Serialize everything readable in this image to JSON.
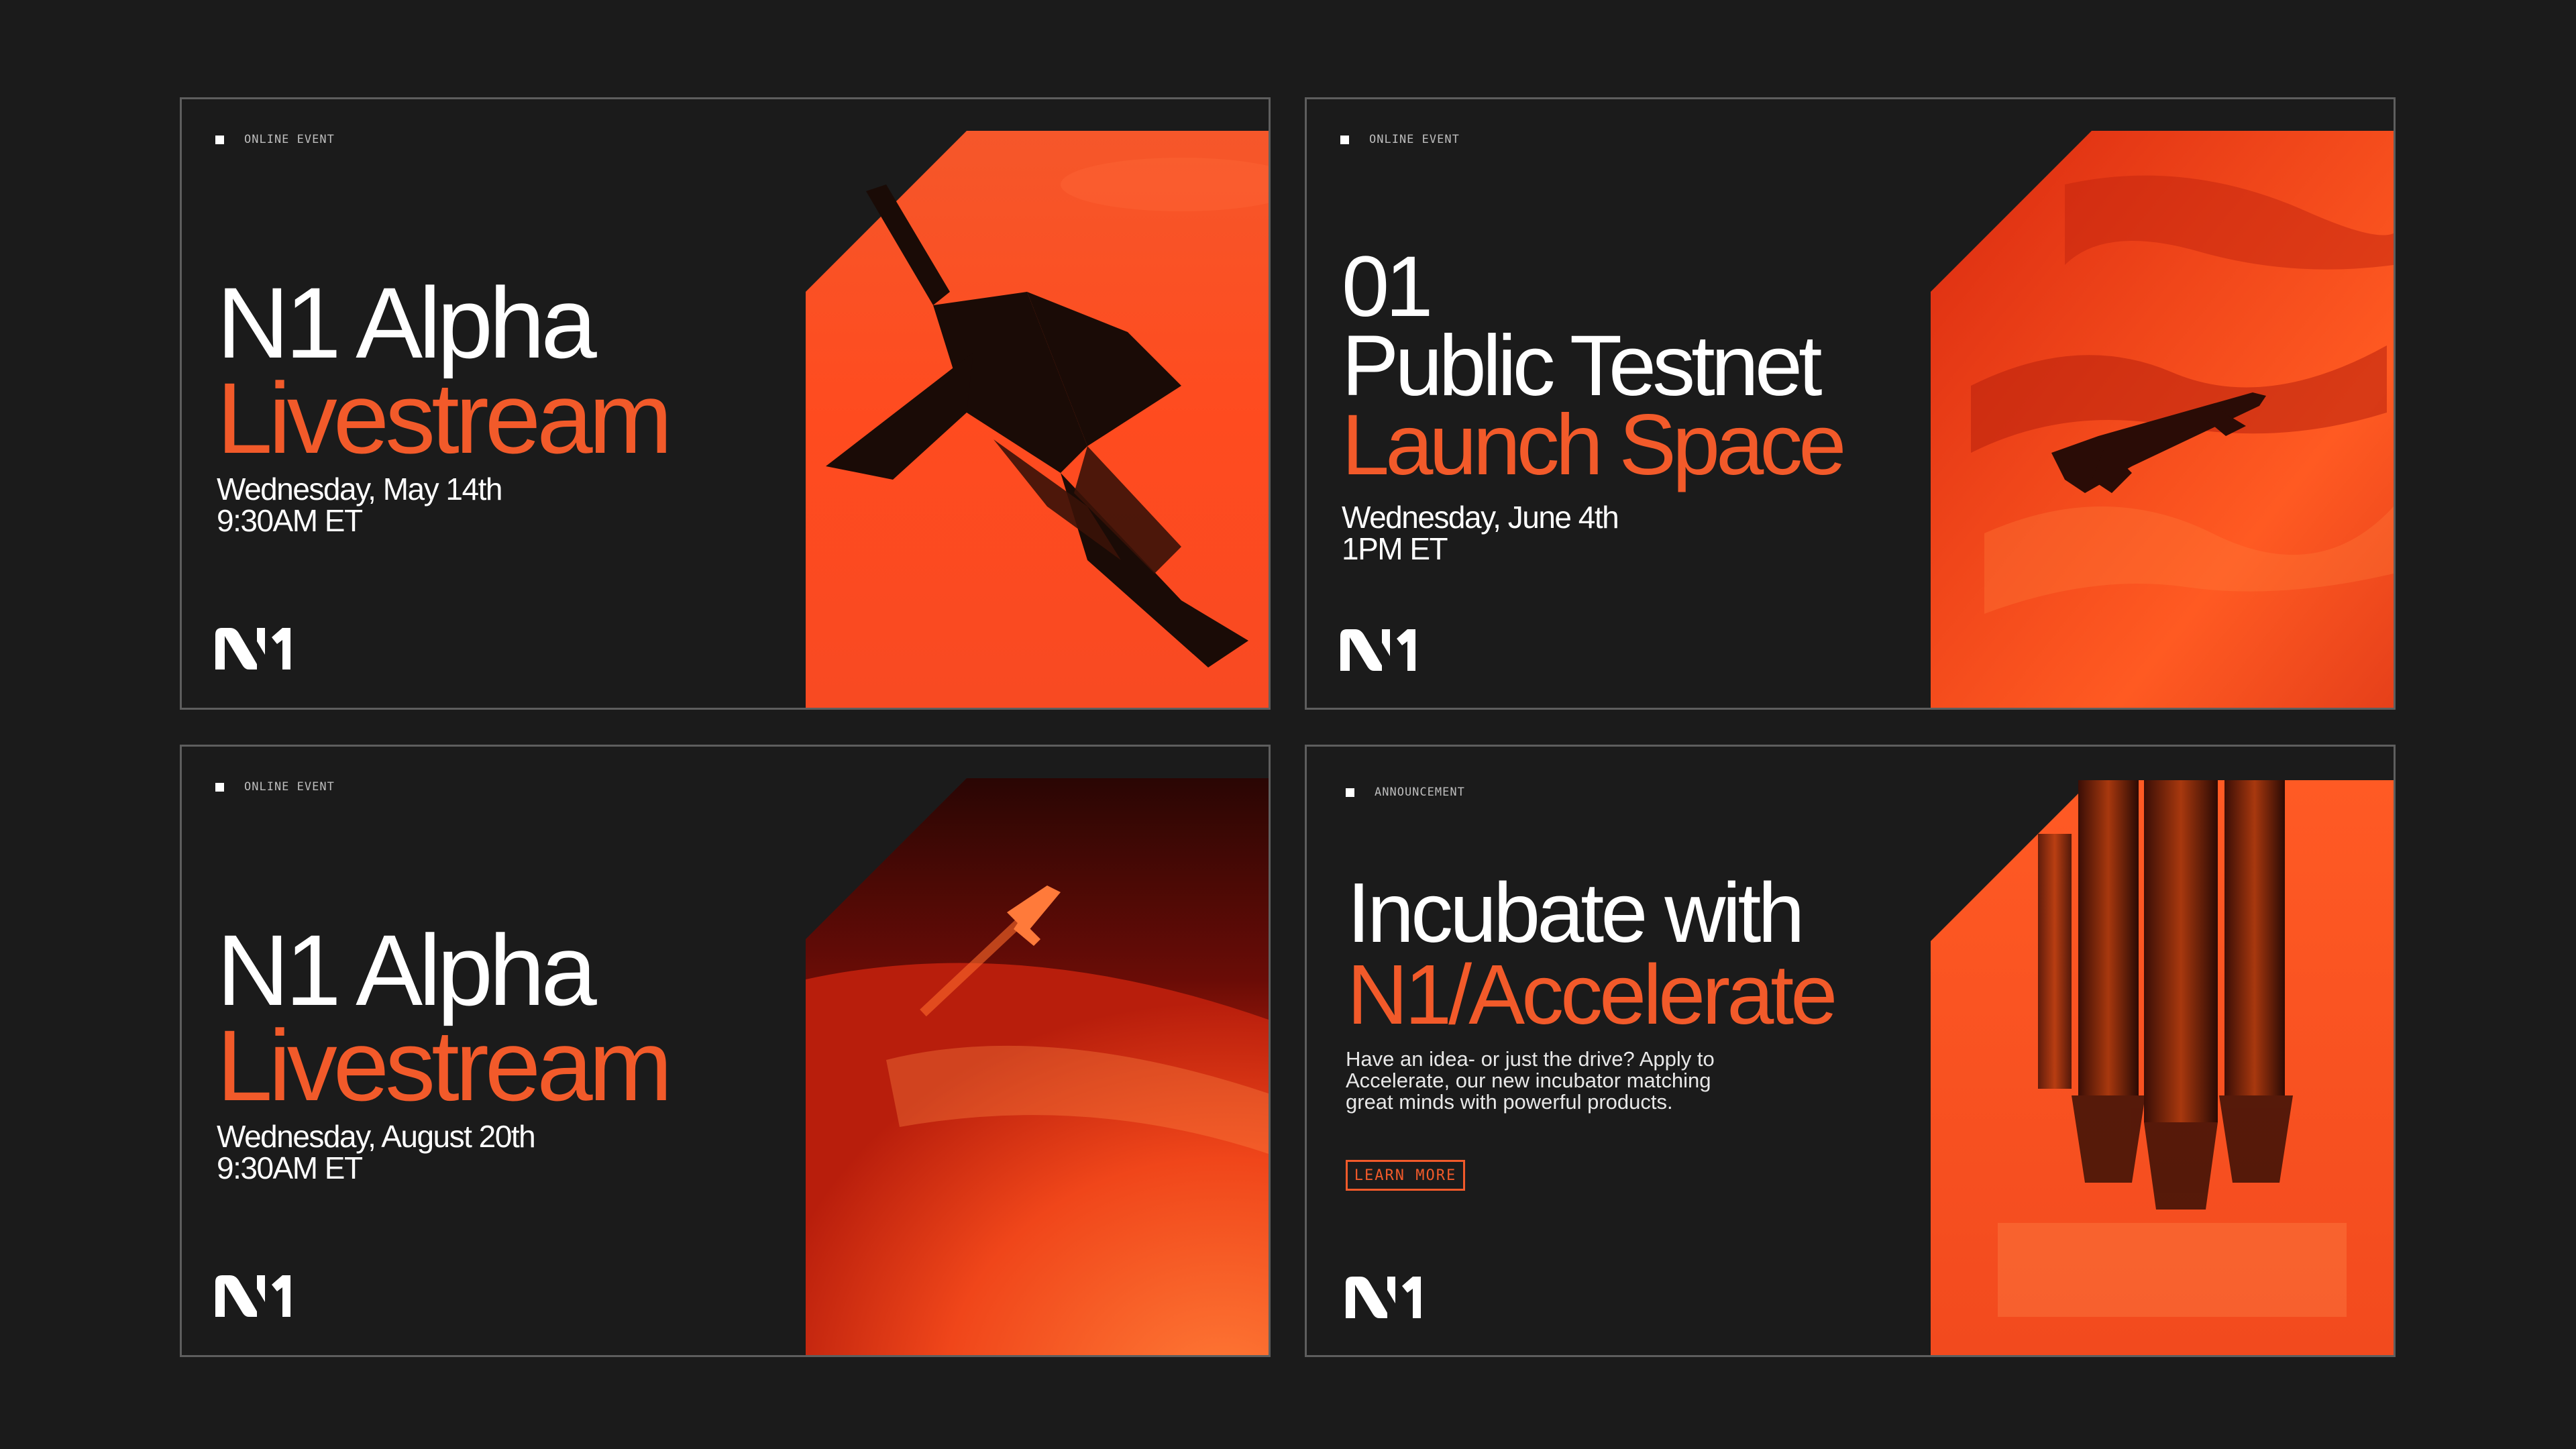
{
  "colors": {
    "background": "#1b1b1b",
    "accent": "#f25a2a",
    "text": "#ffffff",
    "border": "#5e5e5e"
  },
  "cards": [
    {
      "tag": "ONLINE EVENT",
      "title_white": "N1 Alpha",
      "title_orange": "Livestream",
      "date_line1": "Wednesday, May 14th",
      "date_line2": "9:30AM ET",
      "image": "space-shuttle-descending-image",
      "logo": "n1-logo-icon"
    },
    {
      "tag": "ONLINE EVENT",
      "title_white_1": "01",
      "title_white_2": "Public Testnet",
      "title_orange": "Launch Space",
      "date_line1": "Wednesday, June 4th",
      "date_line2": "1PM ET",
      "image": "shuttle-over-red-clouds-image",
      "logo": "n1-logo-icon"
    },
    {
      "tag": "ONLINE EVENT",
      "title_white": "N1 Alpha",
      "title_orange": "Livestream",
      "date_line1": "Wednesday, August 20th",
      "date_line2": "9:30AM ET",
      "image": "shuttle-above-planet-image",
      "logo": "n1-logo-icon"
    },
    {
      "tag": "ANNOUNCEMENT",
      "title_white": "Incubate with",
      "title_orange": "N1/Accelerate",
      "body_line1": "Have an idea- or just the drive? Apply to",
      "body_line2": "Accelerate, our new incubator matching",
      "body_line3": "great minds with powerful products.",
      "cta": "LEARN MORE",
      "image": "rocket-engines-image",
      "logo": "n1-logo-icon"
    }
  ]
}
